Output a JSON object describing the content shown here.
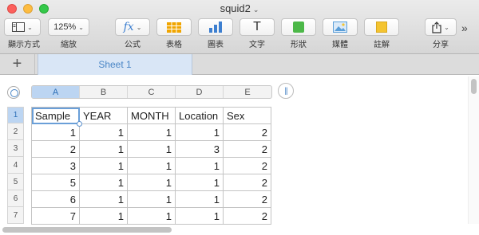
{
  "window": {
    "title": "squid2",
    "title_caret": "⌄"
  },
  "toolbar": {
    "view": {
      "label": "顯示方式",
      "icon": "sidebar-view-icon",
      "chevron": "⌄"
    },
    "zoom": {
      "label": "縮放",
      "value": "125%",
      "chevron": "⌄"
    },
    "formula": {
      "label": "公式",
      "icon_text": "fx",
      "chevron": "⌄"
    },
    "table": {
      "label": "表格",
      "icon": "table-icon"
    },
    "chart": {
      "label": "圖表",
      "icon": "bar-chart-icon"
    },
    "text": {
      "label": "文字",
      "icon_text": "T"
    },
    "shape": {
      "label": "形狀",
      "icon": "shape-square-icon"
    },
    "media": {
      "label": "媒體",
      "icon": "image-icon"
    },
    "comment": {
      "label": "註解",
      "icon": "comment-icon"
    },
    "share": {
      "label": "分享",
      "icon": "share-icon",
      "chevron": "⌄"
    },
    "overflow": "»",
    "colors": {
      "formula_accent": "#3d7fd0",
      "table_accent": "#f0a500",
      "chart_accent": "#3d7fd0",
      "shape_accent": "#4cb848",
      "media_accent": "#5a9ed8",
      "comment_accent": "#f4c430"
    }
  },
  "tabs": {
    "add_label": "+",
    "sheets": [
      {
        "label": "Sheet 1",
        "active": true
      }
    ]
  },
  "spreadsheet": {
    "column_headers": [
      "A",
      "B",
      "C",
      "D",
      "E"
    ],
    "selected_column": "A",
    "row_headers": [
      "1",
      "2",
      "3",
      "4",
      "5",
      "6",
      "7"
    ],
    "selected_row": "1",
    "rows": [
      [
        "Sample",
        "YEAR",
        "MONTH",
        "Location",
        "Sex"
      ],
      [
        "1",
        "1",
        "1",
        "1",
        "2"
      ],
      [
        "2",
        "1",
        "1",
        "3",
        "2"
      ],
      [
        "3",
        "1",
        "1",
        "1",
        "2"
      ],
      [
        "5",
        "1",
        "1",
        "1",
        "2"
      ],
      [
        "6",
        "1",
        "1",
        "1",
        "2"
      ],
      [
        "7",
        "1",
        "1",
        "1",
        "2"
      ]
    ],
    "selected_cell": "A1",
    "column_handle_icon": "||"
  },
  "colors": {
    "selection": "#bcd5f2",
    "accent_blue": "#4a86c6",
    "close": "#fc605c",
    "minimize": "#fdbc40",
    "maximize": "#34c84a"
  }
}
